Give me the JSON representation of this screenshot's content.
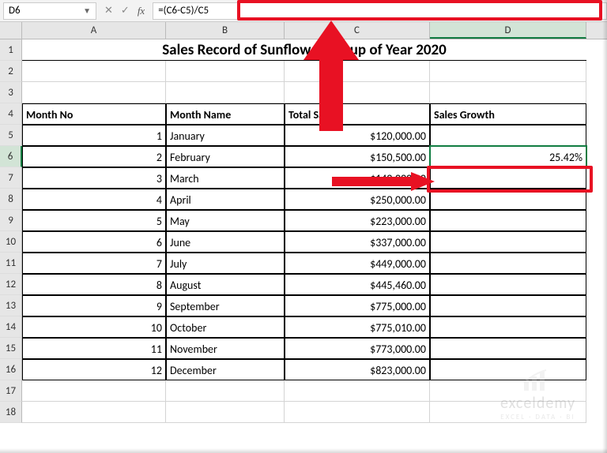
{
  "nameBox": "D6",
  "formula": "=(C6-C5)/C5",
  "fbButtons": {
    "cancel": "✕",
    "confirm": "✓",
    "fx": "fx"
  },
  "colHeaders": [
    "A",
    "B",
    "C",
    "D"
  ],
  "rowHeaders": [
    "1",
    "2",
    "3",
    "4",
    "5",
    "6",
    "7",
    "8",
    "9",
    "10",
    "11",
    "12",
    "13",
    "14",
    "15",
    "16",
    "17",
    "18"
  ],
  "title": "Sales Record of Sunflower Group of Year 2020",
  "headers": {
    "monthNo": "Month No",
    "monthName": "Month Name",
    "totalSales": "Total Sales",
    "salesGrowth": "Sales Growth"
  },
  "data": [
    {
      "no": "1",
      "name": "January",
      "sales": "$120,000.00",
      "growth": ""
    },
    {
      "no": "2",
      "name": "February",
      "sales": "$150,500.00",
      "growth": "25.42%"
    },
    {
      "no": "3",
      "name": "March",
      "sales": "$140,000.00",
      "growth": ""
    },
    {
      "no": "4",
      "name": "April",
      "sales": "$250,000.00",
      "growth": ""
    },
    {
      "no": "5",
      "name": "May",
      "sales": "$223,000.00",
      "growth": ""
    },
    {
      "no": "6",
      "name": "June",
      "sales": "$337,000.00",
      "growth": ""
    },
    {
      "no": "7",
      "name": "July",
      "sales": "$449,000.00",
      "growth": ""
    },
    {
      "no": "8",
      "name": "August",
      "sales": "$445,460.00",
      "growth": ""
    },
    {
      "no": "9",
      "name": "September",
      "sales": "$775,000.00",
      "growth": ""
    },
    {
      "no": "10",
      "name": "October",
      "sales": "$775,010.00",
      "growth": ""
    },
    {
      "no": "11",
      "name": "November",
      "sales": "$773,000.00",
      "growth": ""
    },
    {
      "no": "12",
      "name": "December",
      "sales": "$823,000.00",
      "growth": ""
    }
  ],
  "watermark": {
    "main": "exceldemy",
    "sub": "EXCEL · DATA · BI"
  }
}
